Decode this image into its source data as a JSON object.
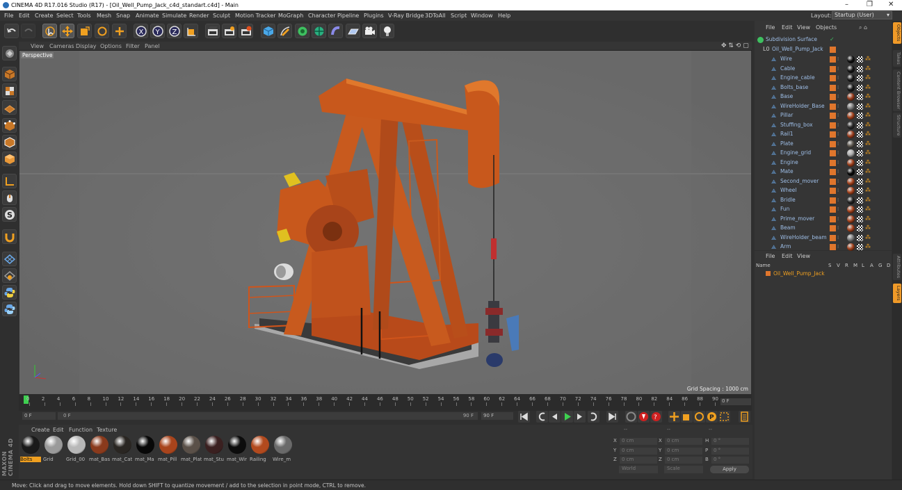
{
  "window": {
    "title": "CINEMA 4D R17.016 Studio (R17) - [Oil_Well_Pump_Jack_c4d_standart.c4d] - Main",
    "controls": [
      "–",
      "❐",
      "✕"
    ]
  },
  "menubar": {
    "items": [
      "File",
      "Edit",
      "Create",
      "Select",
      "Tools",
      "Mesh",
      "Snap",
      "Animate",
      "Simulate",
      "Render",
      "Sculpt",
      "Motion Tracker",
      "MoGraph",
      "Character",
      "Pipeline",
      "Plugins",
      "V-Ray Bridge",
      "3DToAll",
      "Script",
      "Window",
      "Help"
    ],
    "layout_label": "Layout:",
    "layout_value": "Startup (User)"
  },
  "viewport": {
    "menu": [
      "View",
      "Cameras",
      "Display",
      "Options",
      "Filter",
      "Panel"
    ],
    "label": "Perspective",
    "grid_spacing": "Grid Spacing : 1000 cm"
  },
  "timeline": {
    "ticks": [
      "0",
      "2",
      "4",
      "6",
      "8",
      "10",
      "12",
      "14",
      "16",
      "18",
      "20",
      "22",
      "24",
      "26",
      "28",
      "30",
      "32",
      "34",
      "36",
      "38",
      "40",
      "42",
      "44",
      "46",
      "48",
      "50",
      "52",
      "54",
      "56",
      "58",
      "60",
      "62",
      "64",
      "66",
      "68",
      "70",
      "72",
      "74",
      "76",
      "78",
      "80",
      "82",
      "84",
      "86",
      "88",
      "90"
    ],
    "current_frame": "0 F",
    "start_field": "0 F",
    "range_start": "0 F",
    "range_end": "90 F",
    "end_field": "90 F"
  },
  "material_manager": {
    "menu": [
      "Create",
      "Edit",
      "Function",
      "Texture"
    ],
    "materials": [
      {
        "name": "Bolts",
        "color": "#1a1a1a",
        "selected": true
      },
      {
        "name": "Grid",
        "color": "#9a9a9a"
      },
      {
        "name": "Grid_00",
        "color": "#b8b8b8"
      },
      {
        "name": "mat_Bas",
        "color": "#8a3a1c"
      },
      {
        "name": "mat_Cat",
        "color": "#2a2622"
      },
      {
        "name": "mat_Ma",
        "color": "#080808"
      },
      {
        "name": "mat_Pill",
        "color": "#a8441c"
      },
      {
        "name": "mat_Plat",
        "color": "#5a5048"
      },
      {
        "name": "mat_Stu",
        "color": "#3a2020"
      },
      {
        "name": "mat_Wir",
        "color": "#0c0c0c"
      },
      {
        "name": "Railing",
        "color": "#b24a1e"
      },
      {
        "name": "Wire_m",
        "color": "#6a6a6a"
      }
    ]
  },
  "coordinates": {
    "header": [
      "--",
      "--",
      "--"
    ],
    "rows": [
      {
        "a": "X",
        "v1": "0 cm",
        "b": "X",
        "v2": "0 cm",
        "c": "H",
        "v3": "0 °"
      },
      {
        "a": "Y",
        "v1": "0 cm",
        "b": "Y",
        "v2": "0 cm",
        "c": "P",
        "v3": "0 °"
      },
      {
        "a": "Z",
        "v1": "0 cm",
        "b": "Z",
        "v2": "0 cm",
        "c": "B",
        "v3": "0 °"
      }
    ],
    "world": "World",
    "scale": "Scale",
    "apply": "Apply"
  },
  "objects_panel": {
    "menu": [
      "File",
      "Edit",
      "View",
      "Objects"
    ],
    "root": "Subdivision Surface",
    "group": "Oil_Well_Pump_Jack",
    "children": [
      {
        "name": "Wire",
        "mat": "#111111"
      },
      {
        "name": "Cable",
        "mat": "#161616"
      },
      {
        "name": "Engine_cable",
        "mat": "#1a1a1a"
      },
      {
        "name": "Bolts_base",
        "mat": "#1a1a1a"
      },
      {
        "name": "Base",
        "mat": "#9a3c1c"
      },
      {
        "name": "WireHolder_Base",
        "mat": "#7a7a7a"
      },
      {
        "name": "Pillar",
        "mat": "#a4421c"
      },
      {
        "name": "Stuffing_box",
        "mat": "#2a2a2a"
      },
      {
        "name": "Rail1",
        "mat": "#9a3c1c"
      },
      {
        "name": "Plate",
        "mat": "#5e5850"
      },
      {
        "name": "Engine_grid",
        "mat": "#aaaaaa"
      },
      {
        "name": "Engine",
        "mat": "#a0401c"
      },
      {
        "name": "Mate",
        "mat": "#080808"
      },
      {
        "name": "Second_mover",
        "mat": "#a4421c"
      },
      {
        "name": "Wheel",
        "mat": "#a4421c"
      },
      {
        "name": "Bridle",
        "mat": "#222222"
      },
      {
        "name": "Fun",
        "mat": "#a4421c"
      },
      {
        "name": "Prime_mover",
        "mat": "#a4421c"
      },
      {
        "name": "Beam",
        "mat": "#a4421c"
      },
      {
        "name": "WireHolder_beam",
        "mat": "#7a7a7a"
      },
      {
        "name": "Arm",
        "mat": "#a4421c"
      }
    ]
  },
  "layers_panel": {
    "menu": [
      "File",
      "Edit",
      "View"
    ],
    "name_col": "Name",
    "cols": [
      "S",
      "V",
      "R",
      "M",
      "L",
      "A",
      "G",
      "D"
    ],
    "item": "Oil_Well_Pump_Jack"
  },
  "right_tabs": [
    "Objects",
    "Takes",
    "Content Browser",
    "Structure",
    "Attributes",
    "Layers"
  ],
  "status": "Move: Click and drag to move elements. Hold down SHIFT to quantize movement / add to the selection in point mode, CTRL to remove.",
  "branding": "MAXON CINEMA 4D"
}
